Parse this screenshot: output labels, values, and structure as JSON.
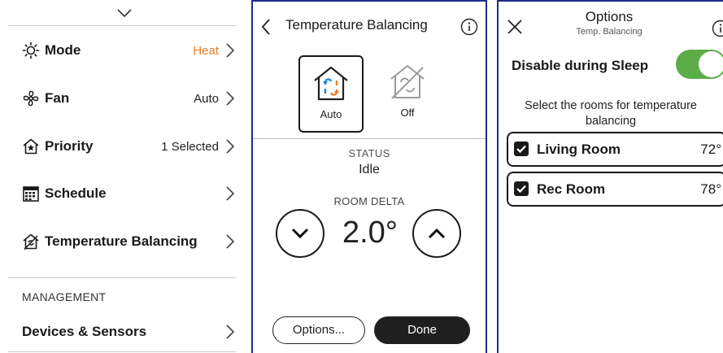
{
  "menu": {
    "items": [
      {
        "icon": "sun-icon",
        "label": "Mode",
        "value": "Heat",
        "value_color": "#f07c22"
      },
      {
        "icon": "fan-icon",
        "label": "Fan",
        "value": "Auto"
      },
      {
        "icon": "house-star-icon",
        "label": "Priority",
        "value": "1 Selected"
      },
      {
        "icon": "calendar-icon",
        "label": "Schedule",
        "value": ""
      },
      {
        "icon": "house-balance-icon",
        "label": "Temperature Balancing",
        "value": ""
      }
    ],
    "section_label": "MANAGEMENT",
    "management_items": [
      {
        "label": "Devices & Sensors"
      }
    ]
  },
  "balancing": {
    "title": "Temperature Balancing",
    "modes": [
      {
        "label": "Auto",
        "icon": "house-arrows-icon",
        "selected": true
      },
      {
        "label": "Off",
        "icon": "house-arrows-off-icon",
        "selected": false
      }
    ],
    "status_label": "STATUS",
    "status_value": "Idle",
    "delta_label": "ROOM DELTA",
    "delta_value": "2.0°",
    "options_button": "Options...",
    "done_button": "Done"
  },
  "options": {
    "title": "Options",
    "subtitle": "Temp. Balancing",
    "sleep_label": "Disable during Sleep",
    "sleep_enabled": true,
    "instructions": "Select the rooms for temperature balancing",
    "rooms": [
      {
        "name": "Living Room",
        "temp": "72°",
        "checked": true
      },
      {
        "name": "Rec Room",
        "temp": "78°",
        "checked": true
      }
    ]
  },
  "colors": {
    "accent_orange": "#f07c22",
    "toggle_green": "#5cad47",
    "panel_border": "#1b2b8c",
    "arrow_blue": "#1e88e5",
    "arrow_orange": "#f07c22"
  }
}
